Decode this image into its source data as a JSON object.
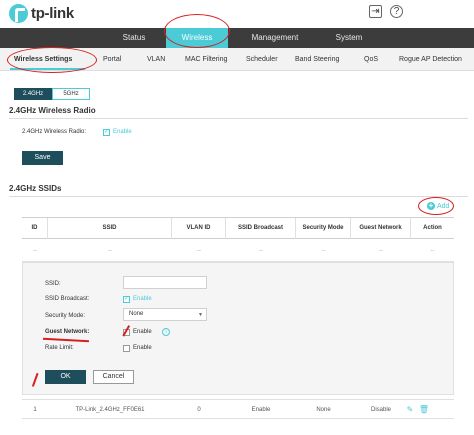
{
  "header": {
    "brand": "tp-link",
    "logout_icon": "logout-icon",
    "help_icon": "help-icon"
  },
  "topnav": {
    "tabs": [
      {
        "label": "Status",
        "active": false
      },
      {
        "label": "Wireless",
        "active": true
      },
      {
        "label": "Management",
        "active": false
      },
      {
        "label": "System",
        "active": false
      }
    ]
  },
  "subnav": {
    "items": [
      {
        "label": "Wireless Settings",
        "active": true
      },
      {
        "label": "Portal",
        "active": false
      },
      {
        "label": "VLAN",
        "active": false
      },
      {
        "label": "MAC Filtering",
        "active": false
      },
      {
        "label": "Scheduler",
        "active": false
      },
      {
        "label": "Band Steering",
        "active": false
      },
      {
        "label": "QoS",
        "active": false
      },
      {
        "label": "Rogue AP Detection",
        "active": false
      }
    ]
  },
  "band": {
    "options": [
      "2.4GHz",
      "5GHz"
    ],
    "selected": "2.4GHz"
  },
  "radio_section": {
    "title": "2.4GHz Wireless Radio",
    "radio_label": "2.4GHz Wireless Radio:",
    "enable_label": "Enable",
    "enabled": true,
    "save_label": "Save"
  },
  "ssid_section": {
    "title": "2.4GHz SSIDs",
    "add_label": "Add",
    "columns": [
      "ID",
      "SSID",
      "VLAN ID",
      "SSID Broadcast",
      "Security Mode",
      "Guest Network",
      "Action"
    ],
    "placeholder_row": [
      "--",
      "--",
      "--",
      "--",
      "--",
      "--",
      "--"
    ],
    "rows": [
      {
        "id": "1",
        "ssid": "TP-Link_2.4GHz_FF0E61",
        "vlan": "0",
        "broadcast": "Enable",
        "security": "None",
        "guest": "Disable"
      }
    ]
  },
  "edit_form": {
    "ssid_label": "SSID:",
    "ssid_value": "",
    "broadcast_label": "SSID Broadcast:",
    "broadcast_enable": "Enable",
    "security_label": "Security Mode:",
    "security_value": "None",
    "guest_label": "Guest Network:",
    "guest_enable": "Enable",
    "rate_label": "Rate Limit:",
    "rate_enable": "Enable",
    "ok_label": "OK",
    "cancel_label": "Cancel"
  },
  "colors": {
    "accent": "#4acbd6",
    "nav_bg": "#3c3c3c",
    "button_dark": "#1e4d5c",
    "annotation": "#d62020"
  }
}
